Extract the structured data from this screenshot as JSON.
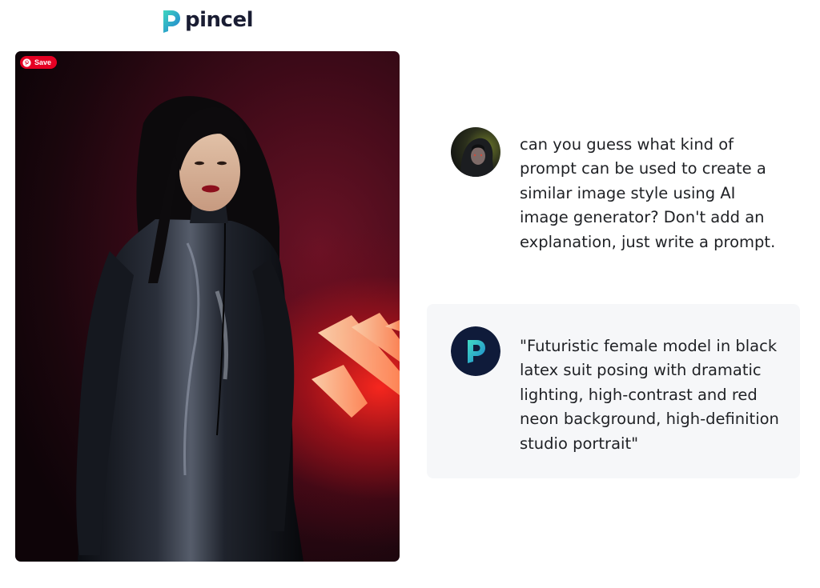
{
  "app": {
    "logo_text": "pincel",
    "logo_icon": "pincel-logo-icon"
  },
  "image_panel": {
    "save_label": "Save",
    "save_icon": "pinterest-icon",
    "description": "Studio portrait photo with red neon background",
    "colors": {
      "save_badge": "#e60023",
      "background_dark": "#1b060d",
      "neon_red": "#ff2a1e"
    }
  },
  "chat": {
    "user_message": {
      "avatar": "user-avatar-icon",
      "text": "can you guess what kind of prompt can be used to create a similar image style using AI image generator? Don't add an explanation, just write a prompt."
    },
    "assistant_message": {
      "avatar": "pincel-avatar-icon",
      "text": "\"Futuristic female model in black latex suit posing with dramatic lighting, high-contrast and red neon background, high-definition studio portrait\""
    }
  },
  "theme": {
    "assistant_bubble_bg": "#f6f7f9",
    "text_color": "#1f2125",
    "logo_text_color": "#1a1d33",
    "brand_teal": "#22c7b0",
    "brand_navy": "#0f1b3a"
  }
}
